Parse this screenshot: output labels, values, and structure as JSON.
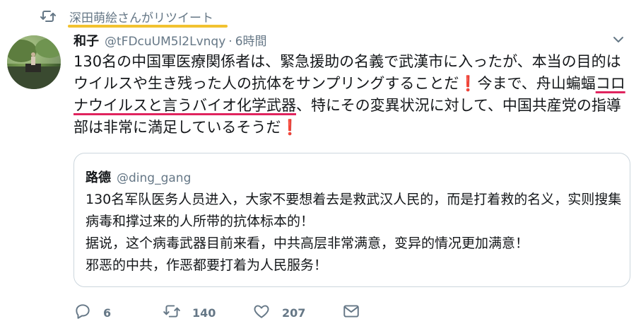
{
  "retweet": {
    "text": "深田萌絵さんがリツイート",
    "icon": "retweet-icon",
    "highlight_color": "#f2c230"
  },
  "author": {
    "name": "和子",
    "handle": "@tFDcuUM5l2Lvnqy",
    "separator": "·",
    "time": "6時間"
  },
  "tweet": {
    "segments": [
      {
        "text": "130名の中国軍医療関係者は、緊急援助の名義で武漢市に入ったが、本当の目的はウイルスや生き残った人の抗体をサンプリングすることだ",
        "style": "plain"
      },
      {
        "text": "❗",
        "style": "ex"
      },
      {
        "text": "今まで、舟山蝙蝠",
        "style": "plain"
      },
      {
        "text": "コロナウイルスと言うバイオ化学武器",
        "style": "ul"
      },
      {
        "text": "、特にその変異状況に対して、中国共産党の指導部は非常に満足しているそうだ",
        "style": "plain"
      },
      {
        "text": "❗",
        "style": "ex"
      }
    ],
    "accent_color": "#e0245e"
  },
  "quote": {
    "name": "路德",
    "handle": "@ding_gang",
    "lines": [
      "130名军队医务人员进入，大家不要想着去是救武汉人民的，而是打着救的名义，实则搜集病毒和撑过来的人所带的抗体标本的！",
      "据说，这个病毒武器目前来看，中共高层非常满意，变异的情况更加满意！",
      "邪恶的中共，作恶都要打着为人民服务！"
    ]
  },
  "actions": {
    "reply_count": "6",
    "retweet_count": "140",
    "like_count": "207",
    "icons": [
      "reply-icon",
      "retweet-icon",
      "like-icon",
      "message-icon"
    ],
    "icon_color": "#657786"
  }
}
